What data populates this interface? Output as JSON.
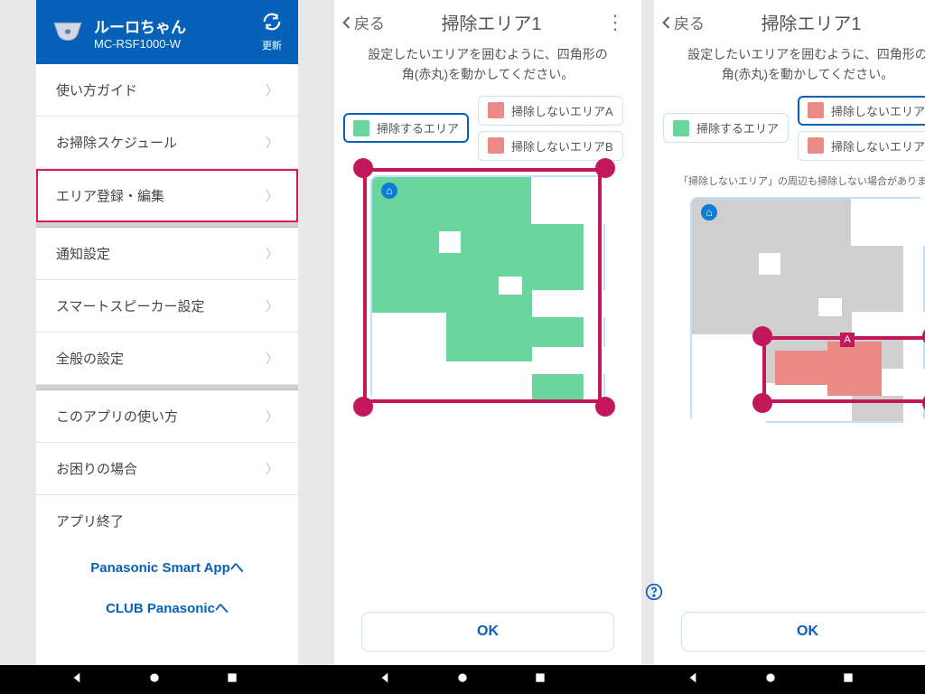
{
  "header": {
    "device_name": "ルーロちゃん",
    "model": "MC-RSF1000-W",
    "refresh_label": "更新"
  },
  "menu": {
    "items": [
      {
        "label": "使い方ガイド"
      },
      {
        "label": "お掃除スケジュール"
      },
      {
        "label": "エリア登録・編集",
        "highlight": true
      },
      {
        "label": "通知設定"
      },
      {
        "label": "スマートスピーカー設定"
      },
      {
        "label": "全般の設定"
      },
      {
        "label": "このアプリの使い方"
      },
      {
        "label": "お困りの場合"
      },
      {
        "label": "アプリ終了"
      }
    ],
    "links": [
      "Panasonic Smart Appへ",
      "CLUB Panasonicへ"
    ]
  },
  "pane": {
    "back": "戻る",
    "title": "掃除エリア1",
    "instruction_l1": "設定したいエリアを囲むように、四角形の",
    "instruction_l2": "角(赤丸)を動かしてください。",
    "legend_clean": "掃除するエリア",
    "legend_skipA": "掃除しないエリアA",
    "legend_skipB": "掃除しないエリアB",
    "skip_note": "「掃除しないエリア」の周辺も掃除しない場合があります",
    "ok": "OK",
    "zone_label_A": "A"
  }
}
